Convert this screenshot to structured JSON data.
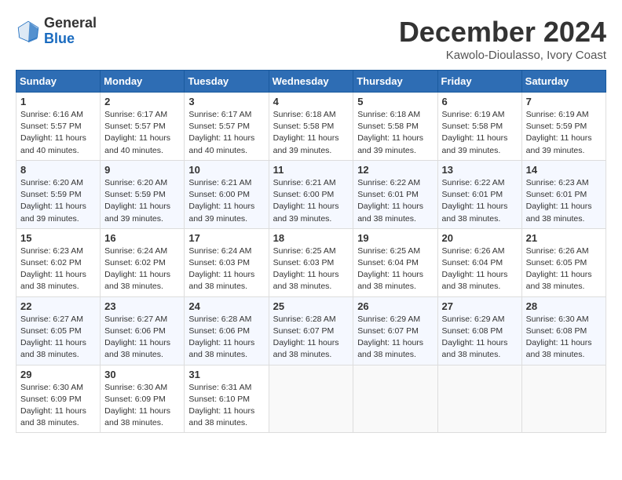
{
  "header": {
    "logo_general": "General",
    "logo_blue": "Blue",
    "month_title": "December 2024",
    "location": "Kawolo-Dioulasso, Ivory Coast"
  },
  "weekdays": [
    "Sunday",
    "Monday",
    "Tuesday",
    "Wednesday",
    "Thursday",
    "Friday",
    "Saturday"
  ],
  "weeks": [
    [
      {
        "day": "1",
        "sunrise": "6:16 AM",
        "sunset": "5:57 PM",
        "daylight": "11 hours and 40 minutes."
      },
      {
        "day": "2",
        "sunrise": "6:17 AM",
        "sunset": "5:57 PM",
        "daylight": "11 hours and 40 minutes."
      },
      {
        "day": "3",
        "sunrise": "6:17 AM",
        "sunset": "5:57 PM",
        "daylight": "11 hours and 40 minutes."
      },
      {
        "day": "4",
        "sunrise": "6:18 AM",
        "sunset": "5:58 PM",
        "daylight": "11 hours and 39 minutes."
      },
      {
        "day": "5",
        "sunrise": "6:18 AM",
        "sunset": "5:58 PM",
        "daylight": "11 hours and 39 minutes."
      },
      {
        "day": "6",
        "sunrise": "6:19 AM",
        "sunset": "5:58 PM",
        "daylight": "11 hours and 39 minutes."
      },
      {
        "day": "7",
        "sunrise": "6:19 AM",
        "sunset": "5:59 PM",
        "daylight": "11 hours and 39 minutes."
      }
    ],
    [
      {
        "day": "8",
        "sunrise": "6:20 AM",
        "sunset": "5:59 PM",
        "daylight": "11 hours and 39 minutes."
      },
      {
        "day": "9",
        "sunrise": "6:20 AM",
        "sunset": "5:59 PM",
        "daylight": "11 hours and 39 minutes."
      },
      {
        "day": "10",
        "sunrise": "6:21 AM",
        "sunset": "6:00 PM",
        "daylight": "11 hours and 39 minutes."
      },
      {
        "day": "11",
        "sunrise": "6:21 AM",
        "sunset": "6:00 PM",
        "daylight": "11 hours and 39 minutes."
      },
      {
        "day": "12",
        "sunrise": "6:22 AM",
        "sunset": "6:01 PM",
        "daylight": "11 hours and 38 minutes."
      },
      {
        "day": "13",
        "sunrise": "6:22 AM",
        "sunset": "6:01 PM",
        "daylight": "11 hours and 38 minutes."
      },
      {
        "day": "14",
        "sunrise": "6:23 AM",
        "sunset": "6:01 PM",
        "daylight": "11 hours and 38 minutes."
      }
    ],
    [
      {
        "day": "15",
        "sunrise": "6:23 AM",
        "sunset": "6:02 PM",
        "daylight": "11 hours and 38 minutes."
      },
      {
        "day": "16",
        "sunrise": "6:24 AM",
        "sunset": "6:02 PM",
        "daylight": "11 hours and 38 minutes."
      },
      {
        "day": "17",
        "sunrise": "6:24 AM",
        "sunset": "6:03 PM",
        "daylight": "11 hours and 38 minutes."
      },
      {
        "day": "18",
        "sunrise": "6:25 AM",
        "sunset": "6:03 PM",
        "daylight": "11 hours and 38 minutes."
      },
      {
        "day": "19",
        "sunrise": "6:25 AM",
        "sunset": "6:04 PM",
        "daylight": "11 hours and 38 minutes."
      },
      {
        "day": "20",
        "sunrise": "6:26 AM",
        "sunset": "6:04 PM",
        "daylight": "11 hours and 38 minutes."
      },
      {
        "day": "21",
        "sunrise": "6:26 AM",
        "sunset": "6:05 PM",
        "daylight": "11 hours and 38 minutes."
      }
    ],
    [
      {
        "day": "22",
        "sunrise": "6:27 AM",
        "sunset": "6:05 PM",
        "daylight": "11 hours and 38 minutes."
      },
      {
        "day": "23",
        "sunrise": "6:27 AM",
        "sunset": "6:06 PM",
        "daylight": "11 hours and 38 minutes."
      },
      {
        "day": "24",
        "sunrise": "6:28 AM",
        "sunset": "6:06 PM",
        "daylight": "11 hours and 38 minutes."
      },
      {
        "day": "25",
        "sunrise": "6:28 AM",
        "sunset": "6:07 PM",
        "daylight": "11 hours and 38 minutes."
      },
      {
        "day": "26",
        "sunrise": "6:29 AM",
        "sunset": "6:07 PM",
        "daylight": "11 hours and 38 minutes."
      },
      {
        "day": "27",
        "sunrise": "6:29 AM",
        "sunset": "6:08 PM",
        "daylight": "11 hours and 38 minutes."
      },
      {
        "day": "28",
        "sunrise": "6:30 AM",
        "sunset": "6:08 PM",
        "daylight": "11 hours and 38 minutes."
      }
    ],
    [
      {
        "day": "29",
        "sunrise": "6:30 AM",
        "sunset": "6:09 PM",
        "daylight": "11 hours and 38 minutes."
      },
      {
        "day": "30",
        "sunrise": "6:30 AM",
        "sunset": "6:09 PM",
        "daylight": "11 hours and 38 minutes."
      },
      {
        "day": "31",
        "sunrise": "6:31 AM",
        "sunset": "6:10 PM",
        "daylight": "11 hours and 38 minutes."
      },
      null,
      null,
      null,
      null
    ]
  ],
  "labels": {
    "sunrise": "Sunrise:",
    "sunset": "Sunset:",
    "daylight": "Daylight:"
  }
}
